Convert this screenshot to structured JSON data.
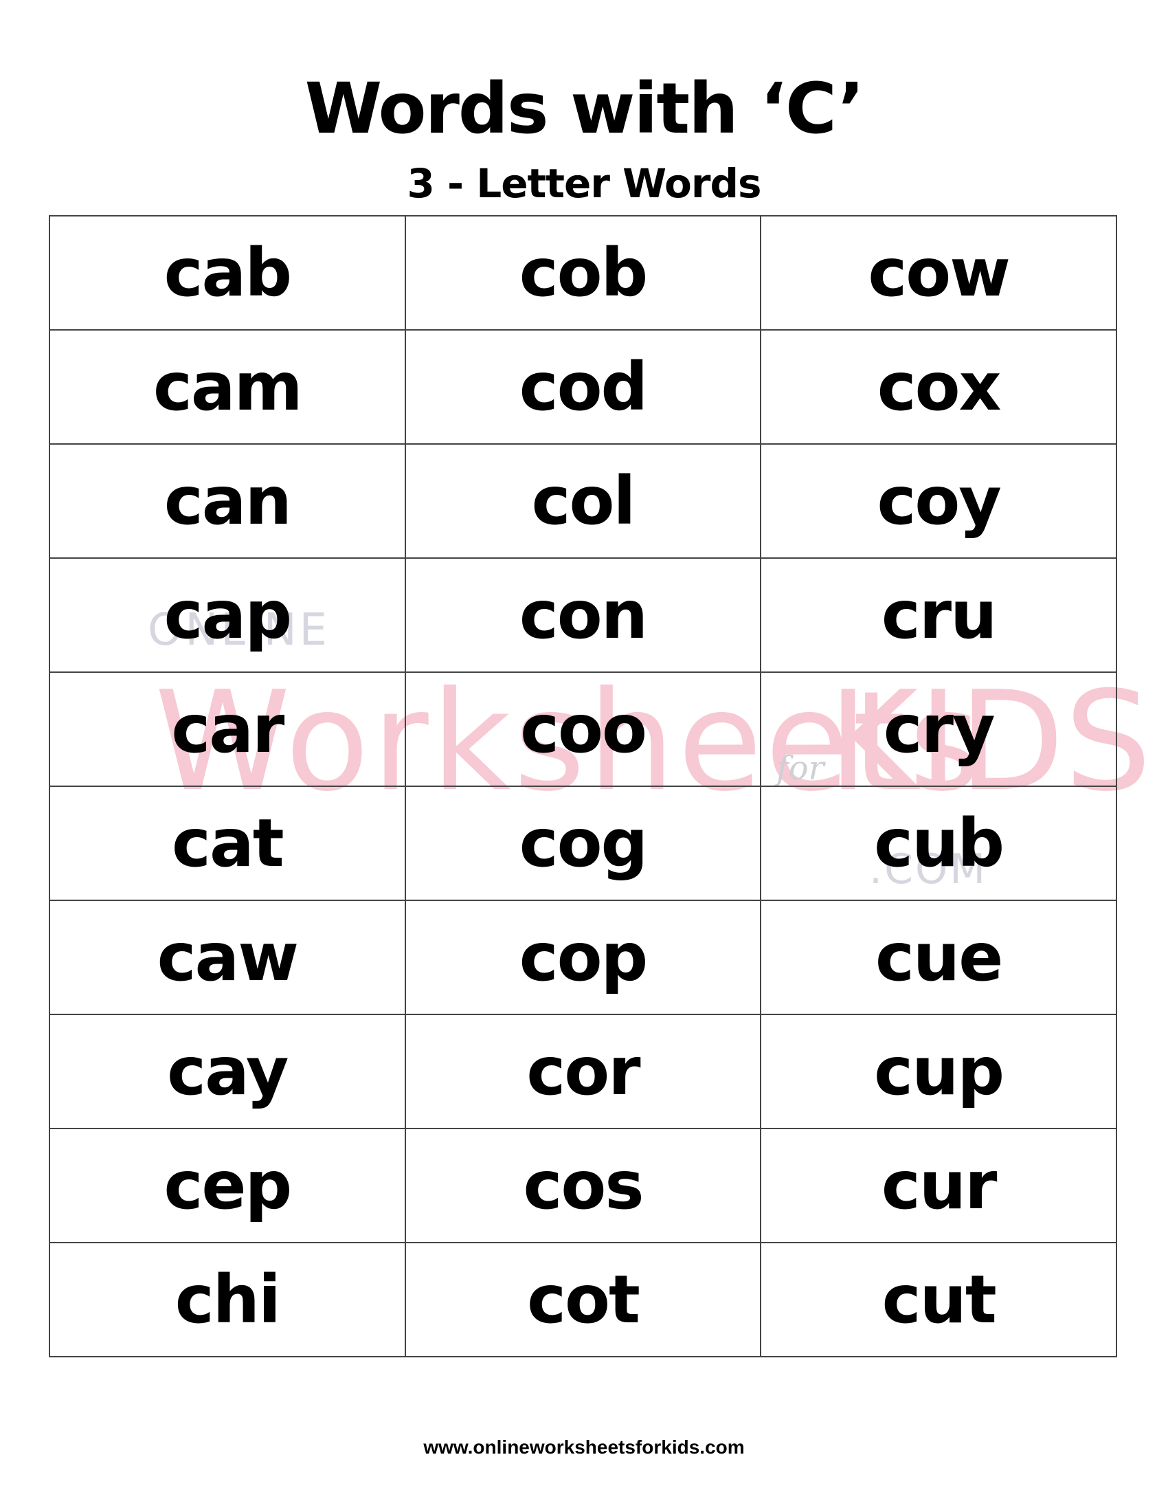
{
  "title": "Words with ‘C’",
  "subtitle": "3 - Letter Words",
  "watermark": {
    "online": "ONLINE",
    "main": "Worksheets",
    "for": "for",
    "kids": "KIDS",
    "com": ".COM"
  },
  "rows": [
    [
      "cab",
      "cob",
      "cow"
    ],
    [
      "cam",
      "cod",
      "cox"
    ],
    [
      "can",
      "col",
      "coy"
    ],
    [
      "cap",
      "con",
      "cru"
    ],
    [
      "car",
      "coo",
      "cry"
    ],
    [
      "cat",
      "cog",
      "cub"
    ],
    [
      "caw",
      "cop",
      "cue"
    ],
    [
      "cay",
      "cor",
      "cup"
    ],
    [
      "cep",
      "cos",
      "cur"
    ],
    [
      "chi",
      "cot",
      "cut"
    ]
  ],
  "footer": "www.onlineworksheetsforkids.com"
}
